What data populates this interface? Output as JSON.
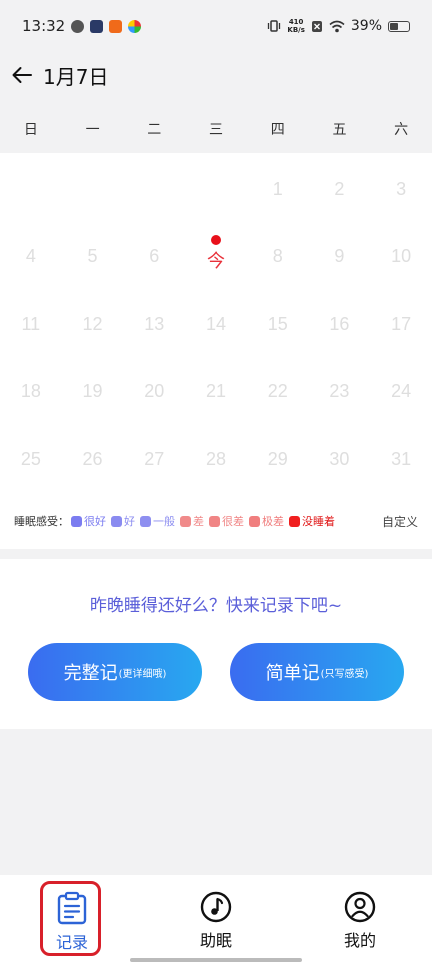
{
  "status_bar": {
    "time": "13:32",
    "net_speed_value": "410",
    "net_speed_unit": "KB/s",
    "battery": "39%",
    "battery_level": 0.39
  },
  "header": {
    "title": "1月7日"
  },
  "weekdays": [
    "日",
    "一",
    "二",
    "三",
    "四",
    "五",
    "六"
  ],
  "calendar": {
    "leading_blanks": 4,
    "today_label": "今",
    "today_index": 5,
    "days": [
      "",
      "",
      "",
      "",
      "1",
      "2",
      "3",
      "4",
      "5",
      "6",
      "今",
      "8",
      "9",
      "10",
      "11",
      "12",
      "13",
      "14",
      "15",
      "16",
      "17",
      "18",
      "19",
      "20",
      "21",
      "22",
      "23",
      "24",
      "25",
      "26",
      "27",
      "28",
      "29",
      "30",
      "31"
    ]
  },
  "legend": {
    "label": "睡眠感受：",
    "items": [
      {
        "text": "很好",
        "color": "#7b7cf0",
        "text_color": "#7b7cf0"
      },
      {
        "text": "好",
        "color": "#8a8bf0",
        "text_color": "#8a8bf0"
      },
      {
        "text": "一般",
        "color": "#8e8ff0",
        "text_color": "#8e8ff0"
      },
      {
        "text": "差",
        "color": "#f08a8a",
        "text_color": "#f08a8a"
      },
      {
        "text": "很差",
        "color": "#f08585",
        "text_color": "#f08585"
      },
      {
        "text": "极差",
        "color": "#f07e7e",
        "text_color": "#f07e7e"
      },
      {
        "text": "没睡着",
        "color": "#f01f1f",
        "text_color": "#e01616"
      }
    ],
    "custom": "自定义"
  },
  "prompt": {
    "text": "昨晚睡得还好么？快来记录下吧~",
    "full_main": "完整记",
    "full_sub": "(更详细哦)",
    "simple_main": "简单记",
    "simple_sub": "(只写感受)"
  },
  "tabs": [
    {
      "label": "记录",
      "icon": "clipboard-icon"
    },
    {
      "label": "助眠",
      "icon": "music-note-icon"
    },
    {
      "label": "我的",
      "icon": "user-icon"
    }
  ],
  "colors": {
    "accent": "#2c63d6",
    "today": "#e8313a",
    "highlight": "#d8202a"
  }
}
